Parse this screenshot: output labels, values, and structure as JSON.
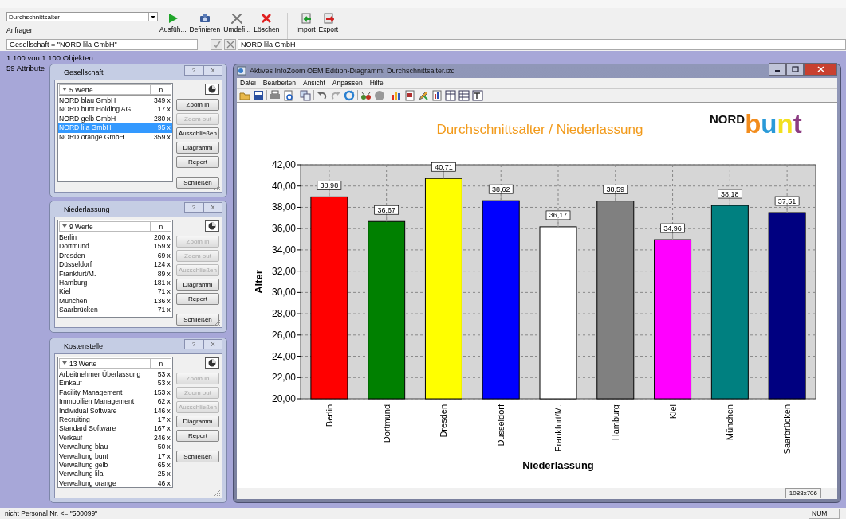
{
  "toolbar": {
    "query_select": "Durchschnittsalter",
    "group_label": "Anfragen",
    "buttons": [
      {
        "kind": "run",
        "label": "Ausfüh..."
      },
      {
        "kind": "define",
        "label": "Definieren"
      },
      {
        "kind": "redefine",
        "label": "Umdefi..."
      },
      {
        "kind": "delete",
        "label": "Löschen"
      },
      {
        "kind": "import",
        "label": "Import"
      },
      {
        "kind": "export",
        "label": "Export"
      }
    ]
  },
  "filter_bar": {
    "expression": "Gesellschaft = \"NORD lila GmbH\"",
    "value": "NORD lila GmbH"
  },
  "info": {
    "objects": "1.100 von 1.100 Objekten",
    "attributes": "59 Attribute"
  },
  "panels": [
    {
      "title": "Gesellschaft",
      "caption_buttons": [
        "?",
        "X"
      ],
      "header": "5 Werte",
      "count_header": "n",
      "rows": [
        {
          "name": "NORD blau GmbH",
          "count": "349 x",
          "selected": false
        },
        {
          "name": "NORD bunt Holding AG",
          "count": "17 x",
          "selected": false
        },
        {
          "name": "NORD gelb GmbH",
          "count": "280 x",
          "selected": false
        },
        {
          "name": "NORD lila GmbH",
          "count": "95 x",
          "selected": true
        },
        {
          "name": "NORD orange GmbH",
          "count": "359 x",
          "selected": false
        }
      ],
      "buttons": [
        {
          "label": "Zoom in",
          "disabled": false
        },
        {
          "label": "Zoom out",
          "disabled": true
        },
        {
          "label": "Ausschließen",
          "disabled": false
        },
        {
          "label": "Diagramm",
          "disabled": false
        },
        {
          "label": "Report",
          "disabled": false
        },
        {
          "label": "Schließen",
          "disabled": false
        }
      ]
    },
    {
      "title": "Niederlassung",
      "caption_buttons": [
        "?",
        "X"
      ],
      "header": "9 Werte",
      "count_header": "n",
      "rows": [
        {
          "name": "Berlin",
          "count": "200 x",
          "selected": false
        },
        {
          "name": "Dortmund",
          "count": "159 x",
          "selected": false
        },
        {
          "name": "Dresden",
          "count": "69 x",
          "selected": false
        },
        {
          "name": "Düsseldorf",
          "count": "124 x",
          "selected": false
        },
        {
          "name": "Frankfurt/M.",
          "count": "89 x",
          "selected": false
        },
        {
          "name": "Hamburg",
          "count": "181 x",
          "selected": false
        },
        {
          "name": "Kiel",
          "count": "71 x",
          "selected": false
        },
        {
          "name": "München",
          "count": "136 x",
          "selected": false
        },
        {
          "name": "Saarbrücken",
          "count": "71 x",
          "selected": false
        }
      ],
      "buttons": [
        {
          "label": "Zoom in",
          "disabled": true
        },
        {
          "label": "Zoom out",
          "disabled": true
        },
        {
          "label": "Ausschließen",
          "disabled": true
        },
        {
          "label": "Diagramm",
          "disabled": false
        },
        {
          "label": "Report",
          "disabled": false
        },
        {
          "label": "Schließen",
          "disabled": false
        }
      ]
    },
    {
      "title": "Kostenstelle",
      "caption_buttons": [
        "?",
        "X"
      ],
      "header": "13 Werte",
      "count_header": "n",
      "rows": [
        {
          "name": "Arbeitnehmer Überlassung",
          "count": "53 x",
          "selected": false
        },
        {
          "name": "Einkauf",
          "count": "53 x",
          "selected": false
        },
        {
          "name": "Facility Management",
          "count": "153 x",
          "selected": false
        },
        {
          "name": "Immobilien Management",
          "count": "62 x",
          "selected": false
        },
        {
          "name": "Individual Software",
          "count": "146 x",
          "selected": false
        },
        {
          "name": "Recruiting",
          "count": "17 x",
          "selected": false
        },
        {
          "name": "Standard Software",
          "count": "167 x",
          "selected": false
        },
        {
          "name": "Verkauf",
          "count": "246 x",
          "selected": false
        },
        {
          "name": "Verwaltung blau",
          "count": "50 x",
          "selected": false
        },
        {
          "name": "Verwaltung bunt",
          "count": "17 x",
          "selected": false
        },
        {
          "name": "Verwaltung gelb",
          "count": "65 x",
          "selected": false
        },
        {
          "name": "Verwaltung lila",
          "count": "25 x",
          "selected": false
        },
        {
          "name": "Verwaltung orange",
          "count": "46 x",
          "selected": false
        }
      ],
      "buttons": [
        {
          "label": "Zoom in",
          "disabled": true
        },
        {
          "label": "Zoom out",
          "disabled": true
        },
        {
          "label": "Ausschließen",
          "disabled": true
        },
        {
          "label": "Diagramm",
          "disabled": false
        },
        {
          "label": "Report",
          "disabled": false
        },
        {
          "label": "Schließen",
          "disabled": false
        }
      ]
    }
  ],
  "chart_window": {
    "title": "Aktives InfoZoom OEM Edition-Diagramm: Durchschnittsalter.izd",
    "menu": [
      "Datei",
      "Bearbeiten",
      "Ansicht",
      "Anpassen",
      "Hilfe"
    ],
    "chart_title": "Durchschnittsalter / Niederlassung",
    "logo": {
      "prefix": "NORD",
      "letters": [
        {
          "char": "b",
          "color": "#f28c1c"
        },
        {
          "char": "u",
          "color": "#2a9ad8"
        },
        {
          "char": "n",
          "color": "#f2e01e"
        },
        {
          "char": "t",
          "color": "#8c3c82"
        }
      ]
    },
    "chart_data": {
      "type": "bar",
      "xlabel": "Niederlassung",
      "ylabel": "Alter",
      "categories": [
        "Berlin",
        "Dortmund",
        "Dresden",
        "Düsseldorf",
        "Frankfurt/M.",
        "Hamburg",
        "Kiel",
        "München",
        "Saarbrücken"
      ],
      "series": [
        {
          "values": [
            38.98,
            36.67,
            40.71,
            38.62,
            36.17,
            38.59,
            34.96,
            38.18,
            37.51
          ]
        }
      ],
      "grid": true,
      "ylim": [
        20,
        42
      ],
      "yticks": [
        {
          "value": 20,
          "label": "20,00"
        },
        {
          "value": 22,
          "label": "22,00"
        },
        {
          "value": 24,
          "label": "24,00"
        },
        {
          "value": 26,
          "label": "26,00"
        },
        {
          "value": 28,
          "label": "28,00"
        },
        {
          "value": 30,
          "label": "30,00"
        },
        {
          "value": 32,
          "label": "32,00"
        },
        {
          "value": 34,
          "label": "34,00"
        },
        {
          "value": 36,
          "label": "36,00"
        },
        {
          "value": 38,
          "label": "38,00"
        },
        {
          "value": 40,
          "label": "40,00"
        },
        {
          "value": 42,
          "label": "42,00"
        }
      ],
      "value_labels": [
        "38,98",
        "36,67",
        "40,71",
        "38,62",
        "36,17",
        "38,59",
        "34,96",
        "38,18",
        "37,51"
      ]
    },
    "bars": [
      {
        "color": "#ff0000"
      },
      {
        "color": "#008000"
      },
      {
        "color": "#ffff00"
      },
      {
        "color": "#0000ff"
      },
      {
        "color": "#ffffff"
      },
      {
        "color": "#808080"
      },
      {
        "color": "#ff00ff"
      },
      {
        "color": "#008080"
      },
      {
        "color": "#000080"
      }
    ],
    "size_label": "1088x706"
  },
  "status_bar": {
    "text": "nicht Personal Nr. <= \"500099\"",
    "indicator": "NUM"
  }
}
